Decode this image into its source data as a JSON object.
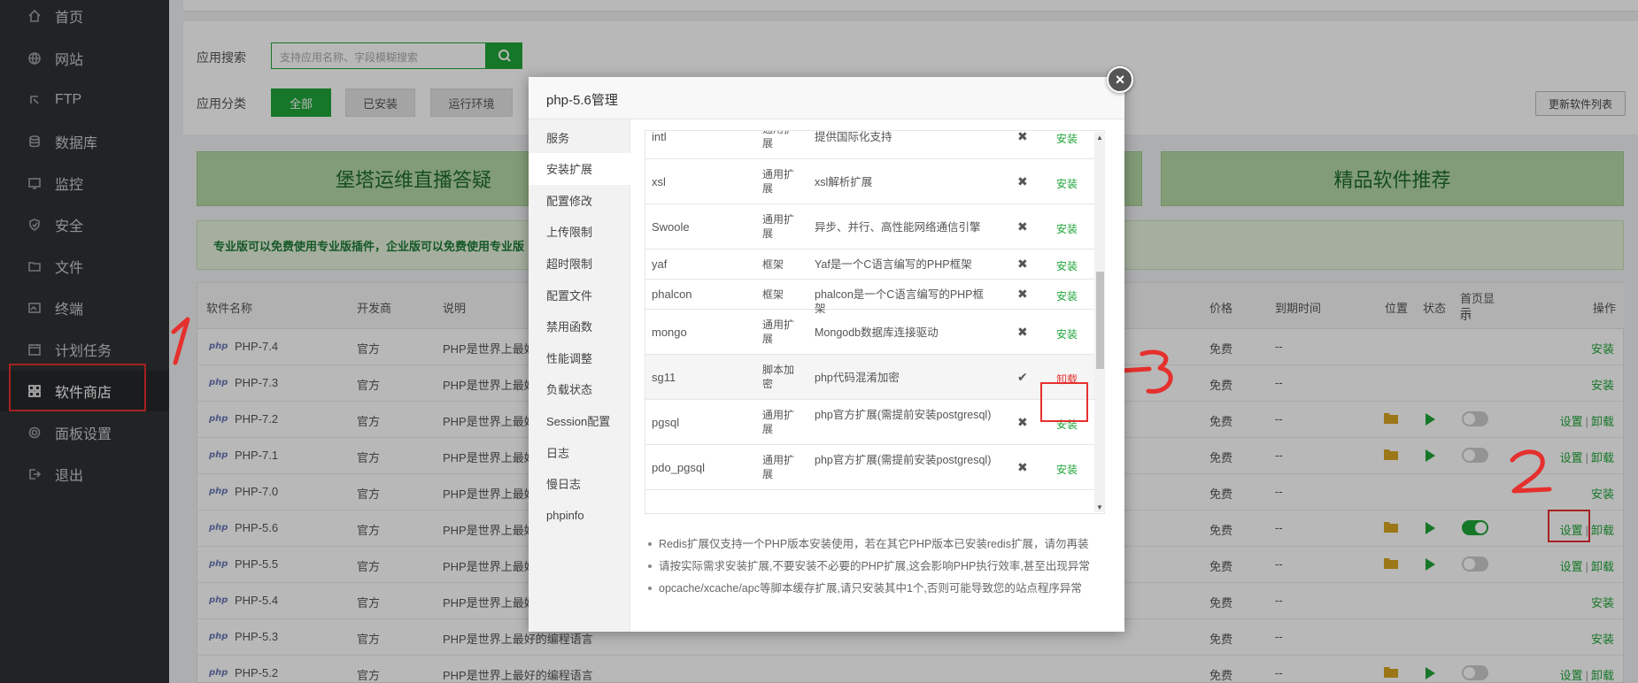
{
  "sidebar": {
    "items": [
      {
        "label": "首页",
        "icon": "home-icon"
      },
      {
        "label": "网站",
        "icon": "globe-icon"
      },
      {
        "label": "FTP",
        "icon": "ftp-icon"
      },
      {
        "label": "数据库",
        "icon": "database-icon"
      },
      {
        "label": "监控",
        "icon": "monitor-icon"
      },
      {
        "label": "安全",
        "icon": "shield-icon"
      },
      {
        "label": "文件",
        "icon": "folder-icon"
      },
      {
        "label": "终端",
        "icon": "terminal-icon"
      },
      {
        "label": "计划任务",
        "icon": "calendar-icon"
      },
      {
        "label": "软件商店",
        "icon": "grid-icon",
        "active": true
      },
      {
        "label": "面板设置",
        "icon": "gear-icon"
      },
      {
        "label": "退出",
        "icon": "logout-icon"
      }
    ]
  },
  "search": {
    "label": "应用搜索",
    "placeholder": "支持应用名称、字段模糊搜索"
  },
  "categories": {
    "label": "应用分类",
    "items": [
      "全部",
      "已安装",
      "运行环境"
    ]
  },
  "refresh_label": "更新软件列表",
  "banners": {
    "left": "堡塔运维直播答疑",
    "right": "精品软件推荐"
  },
  "notice": "专业版可以免费使用专业版插件，企业版可以免费使用专业版",
  "table": {
    "headers": [
      "软件名称",
      "开发商",
      "说明",
      "价格",
      "到期时间",
      "位置",
      "状态",
      "首页显示",
      "操作"
    ],
    "header_extra": "示",
    "rows": [
      {
        "name": "PHP-7.4",
        "dev": "官方",
        "desc": "PHP是世界上最好",
        "price": "免费",
        "expire": "--",
        "ops": [
          "安装"
        ]
      },
      {
        "name": "PHP-7.3",
        "dev": "官方",
        "desc": "PHP是世界上最好",
        "price": "免费",
        "expire": "--",
        "ops": [
          "安装"
        ]
      },
      {
        "name": "PHP-7.2",
        "dev": "官方",
        "desc": "PHP是世界上最好",
        "price": "免费",
        "expire": "--",
        "ops": [
          "设置",
          "卸载"
        ],
        "installed": true,
        "home": false
      },
      {
        "name": "PHP-7.1",
        "dev": "官方",
        "desc": "PHP是世界上最好",
        "price": "免费",
        "expire": "--",
        "ops": [
          "设置",
          "卸载"
        ],
        "installed": true,
        "home": false
      },
      {
        "name": "PHP-7.0",
        "dev": "官方",
        "desc": "PHP是世界上最好",
        "price": "免费",
        "expire": "--",
        "ops": [
          "安装"
        ]
      },
      {
        "name": "PHP-5.6",
        "dev": "官方",
        "desc": "PHP是世界上最好",
        "price": "免费",
        "expire": "--",
        "ops": [
          "设置",
          "卸载"
        ],
        "installed": true,
        "home": true
      },
      {
        "name": "PHP-5.5",
        "dev": "官方",
        "desc": "PHP是世界上最好",
        "price": "免费",
        "expire": "--",
        "ops": [
          "设置",
          "卸载"
        ],
        "installed": true,
        "home": false
      },
      {
        "name": "PHP-5.4",
        "dev": "官方",
        "desc": "PHP是世界上最好",
        "price": "免费",
        "expire": "--",
        "ops": [
          "安装"
        ]
      },
      {
        "name": "PHP-5.3",
        "dev": "官方",
        "desc": "PHP是世界上最好的编程语言",
        "price": "免费",
        "expire": "--",
        "ops": [
          "安装"
        ]
      },
      {
        "name": "PHP-5.2",
        "dev": "官方",
        "desc": "PHP是世界上最好的编程语言",
        "price": "免费",
        "expire": "--",
        "ops": [
          "设置",
          "卸载"
        ],
        "installed": true,
        "home": false
      }
    ]
  },
  "modal": {
    "title": "php-5.6管理",
    "close": "×",
    "nav": [
      "服务",
      "安装扩展",
      "配置修改",
      "上传限制",
      "超时限制",
      "配置文件",
      "禁用函数",
      "性能调整",
      "负载状态",
      "Session配置",
      "日志",
      "慢日志",
      "phpinfo"
    ],
    "extensions": [
      {
        "name": "intl",
        "type": "通用扩展",
        "desc": "提供国际化支持",
        "installed": false,
        "action": "安装"
      },
      {
        "name": "xsl",
        "type": "通用扩展",
        "desc": "xsl解析扩展",
        "installed": false,
        "action": "安装"
      },
      {
        "name": "Swoole",
        "type": "通用扩展",
        "desc": "异步、并行、高性能网络通信引擎",
        "installed": false,
        "action": "安装"
      },
      {
        "name": "yaf",
        "type": "框架",
        "desc": "Yaf是一个C语言编写的PHP框架",
        "installed": false,
        "action": "安装"
      },
      {
        "name": "phalcon",
        "type": "框架",
        "desc": "phalcon是一个C语言编写的PHP框架",
        "installed": false,
        "action": "安装"
      },
      {
        "name": "mongo",
        "type": "通用扩展",
        "desc": "Mongodb数据库连接驱动",
        "installed": false,
        "action": "安装"
      },
      {
        "name": "sg11",
        "type": "脚本加密",
        "desc": "php代码混淆加密",
        "installed": true,
        "action": "卸载"
      },
      {
        "name": "pgsql",
        "type": "通用扩展",
        "desc": "php官方扩展(需提前安装postgresql)",
        "installed": false,
        "action": "安装"
      },
      {
        "name": "pdo_pgsql",
        "type": "通用扩展",
        "desc": "php官方扩展(需提前安装postgresql)",
        "installed": false,
        "action": "安装"
      }
    ],
    "status_marks": {
      "installed": "✔",
      "missing": "✖"
    },
    "tips": [
      "Redis扩展仅支持一个PHP版本安装使用，若在其它PHP版本已安装redis扩展，请勿再装",
      "请按实际需求安装扩展,不要安装不必要的PHP扩展,这会影响PHP执行效率,甚至出现异常",
      "opcache/xcache/apc等脚本缓存扩展,请只安装其中1个,否则可能导致您的站点程序异常"
    ]
  },
  "colors": {
    "accent": "#20a53a",
    "danger": "#e5302e",
    "sidebar": "#2f3133"
  }
}
